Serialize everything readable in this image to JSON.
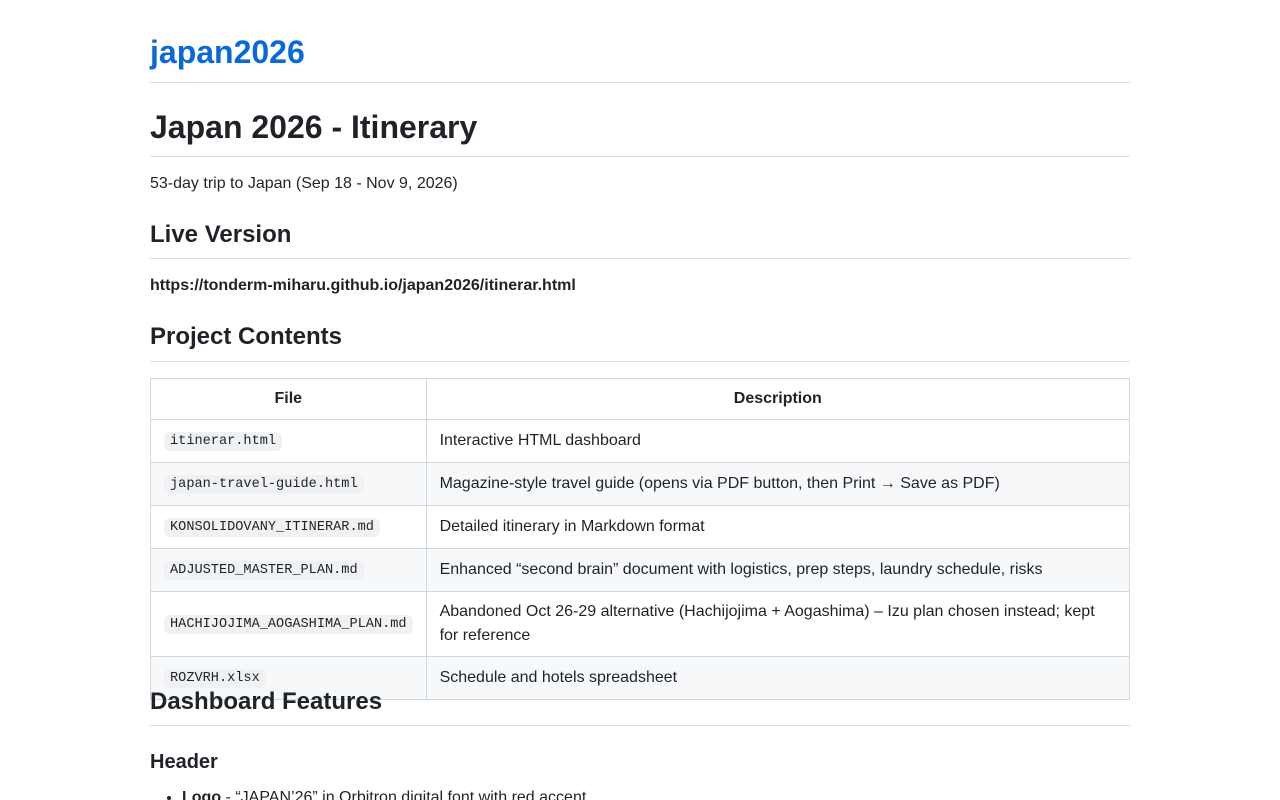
{
  "site": {
    "title": "japan2026"
  },
  "readme": {
    "title": "Japan 2026 - Itinerary",
    "summary": "53-day trip to Japan (Sep 18 - Nov 9, 2026)",
    "live_version": {
      "heading": "Live Version",
      "url": "https://tonderm-miharu.github.io/japan2026/itinerar.html"
    },
    "project_contents": {
      "heading": "Project Contents",
      "columns": [
        "File",
        "Description"
      ],
      "rows": [
        {
          "file": "itinerar.html",
          "description": "Interactive HTML dashboard"
        },
        {
          "file": "japan-travel-guide.html",
          "description": "Magazine-style travel guide (opens via PDF button, then Print → Save as PDF)"
        },
        {
          "file": "KONSOLIDOVANY_ITINERAR.md",
          "description": "Detailed itinerary in Markdown format"
        },
        {
          "file": "ADJUSTED_MASTER_PLAN.md",
          "description": "Enhanced “second brain” document with logistics, prep steps, laundry schedule, risks"
        },
        {
          "file": "HACHIJOJIMA_AOGASHIMA_PLAN.md",
          "description": "Abandoned Oct 26-29 alternative (Hachijojima + Aogashima) – Izu plan chosen instead; kept for reference"
        },
        {
          "file": "ROZVRH.xlsx",
          "description": "Schedule and hotels spreadsheet"
        }
      ]
    },
    "dashboard_features": {
      "heading": "Dashboard Features",
      "header_section": {
        "heading": "Header",
        "items": [
          {
            "label": "Logo",
            "text": " - “JAPAN’26” in Orbitron digital font with red accent"
          }
        ]
      }
    }
  }
}
